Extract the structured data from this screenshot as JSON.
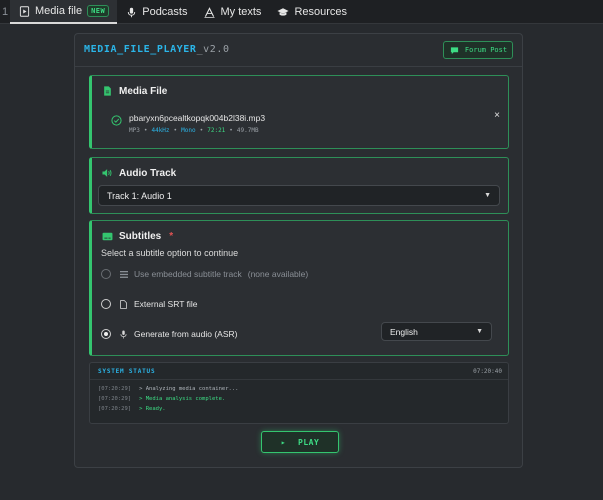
{
  "nav": {
    "edge_glyph": "1",
    "tabs": [
      {
        "label": "Media file",
        "badge": "NEW",
        "icon": "media-file-icon"
      },
      {
        "label": "Podcasts",
        "icon": "microphone-icon"
      },
      {
        "label": "My texts",
        "icon": "text-a-icon"
      },
      {
        "label": "Resources",
        "icon": "graduation-cap-icon"
      }
    ]
  },
  "app": {
    "title_main": "MEDIA_FILE_PLAYER",
    "title_version": "_v2.0",
    "forum_button": "Forum Post"
  },
  "media_file": {
    "heading": "Media File",
    "file_name": "pbaryxn6pcealtkopqk004b2l38i.mp3",
    "format": "MP3",
    "sep": "•",
    "sample_rate": "44kHz",
    "channels": "Mono",
    "duration": "72:21",
    "size": "49.7MB",
    "remove_glyph": "×"
  },
  "audio_track": {
    "heading": "Audio Track",
    "selected": "Track 1: Audio 1"
  },
  "subtitles": {
    "heading": "Subtitles",
    "required_mark": "*",
    "prompt": "Select a subtitle option to continue",
    "options": [
      {
        "label": "Use embedded subtitle track",
        "note": "(none available)",
        "disabled": true
      },
      {
        "label": "External SRT file"
      },
      {
        "label": "Generate from audio (ASR)",
        "selected": true
      }
    ],
    "language": "English"
  },
  "system_status": {
    "title": "SYSTEM STATUS",
    "time": "07:20:40",
    "logs": [
      {
        "ts": "[07:20:29]",
        "msg": "> Analyzing media container...",
        "kind": "info"
      },
      {
        "ts": "[07:20:29]",
        "msg": "> Media analysis complete.",
        "kind": "ok"
      },
      {
        "ts": "[07:20:29]",
        "msg": "> Ready.",
        "kind": "ok"
      }
    ]
  },
  "play": {
    "glyph": "▸",
    "label": "PLAY"
  },
  "colors": {
    "accent_green": "#3ddc84",
    "accent_blue": "#2bb5e8",
    "background": "#272a2e",
    "required_red": "#e05252"
  }
}
